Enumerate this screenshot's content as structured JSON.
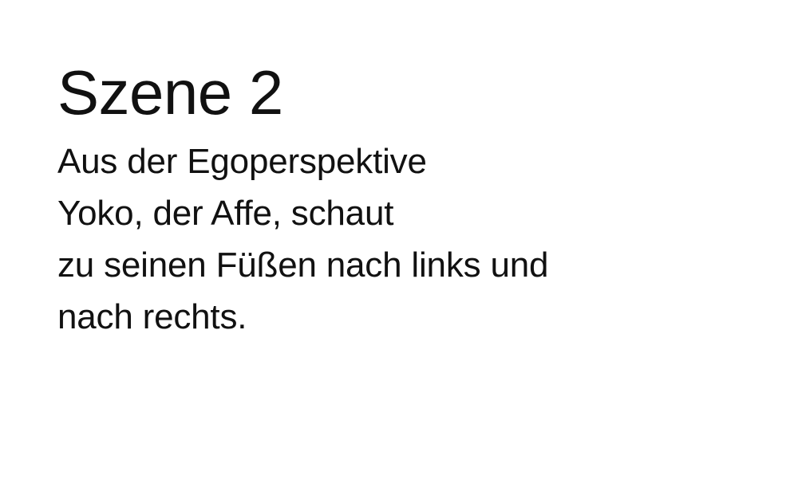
{
  "scene": {
    "title": "Szene 2",
    "lines": [
      "Aus der Egoperspektive",
      "Yoko, der Affe, schaut",
      "zu seinen Füßen nach links und",
      "nach rechts."
    ]
  }
}
